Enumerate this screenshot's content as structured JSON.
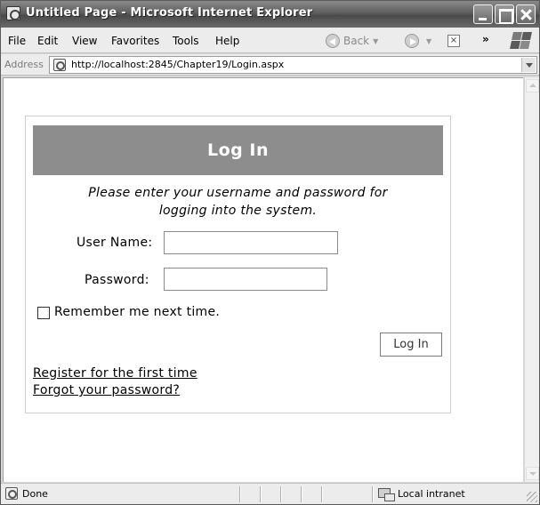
{
  "window": {
    "title": "Untitled Page - Microsoft Internet Explorer"
  },
  "menubar": {
    "items": [
      "File",
      "Edit",
      "View",
      "Favorites",
      "Tools",
      "Help"
    ],
    "back_label": "Back",
    "chevrons": "»"
  },
  "address": {
    "label": "Address",
    "url": "http://localhost:2845/Chapter19/Login.aspx"
  },
  "login": {
    "title": "Log In",
    "instruction_line1": "Please enter your username and password for",
    "instruction_line2": "logging into the system.",
    "username_label": "User Name:",
    "username_value": "",
    "password_label": "Password:",
    "password_value": "",
    "remember_label": "Remember me next time.",
    "remember_checked": false,
    "button_label": "Log In",
    "register_link": "Register for the first time",
    "forgot_link": "Forgot your password?"
  },
  "status": {
    "text": "Done",
    "zone": "Local intranet"
  },
  "icons": {
    "title": "ie-page-icon",
    "back": "back-arrow-icon",
    "forward": "forward-arrow-icon",
    "stop": "stop-icon",
    "logo": "windows-logo-icon",
    "zone": "local-intranet-icon"
  }
}
